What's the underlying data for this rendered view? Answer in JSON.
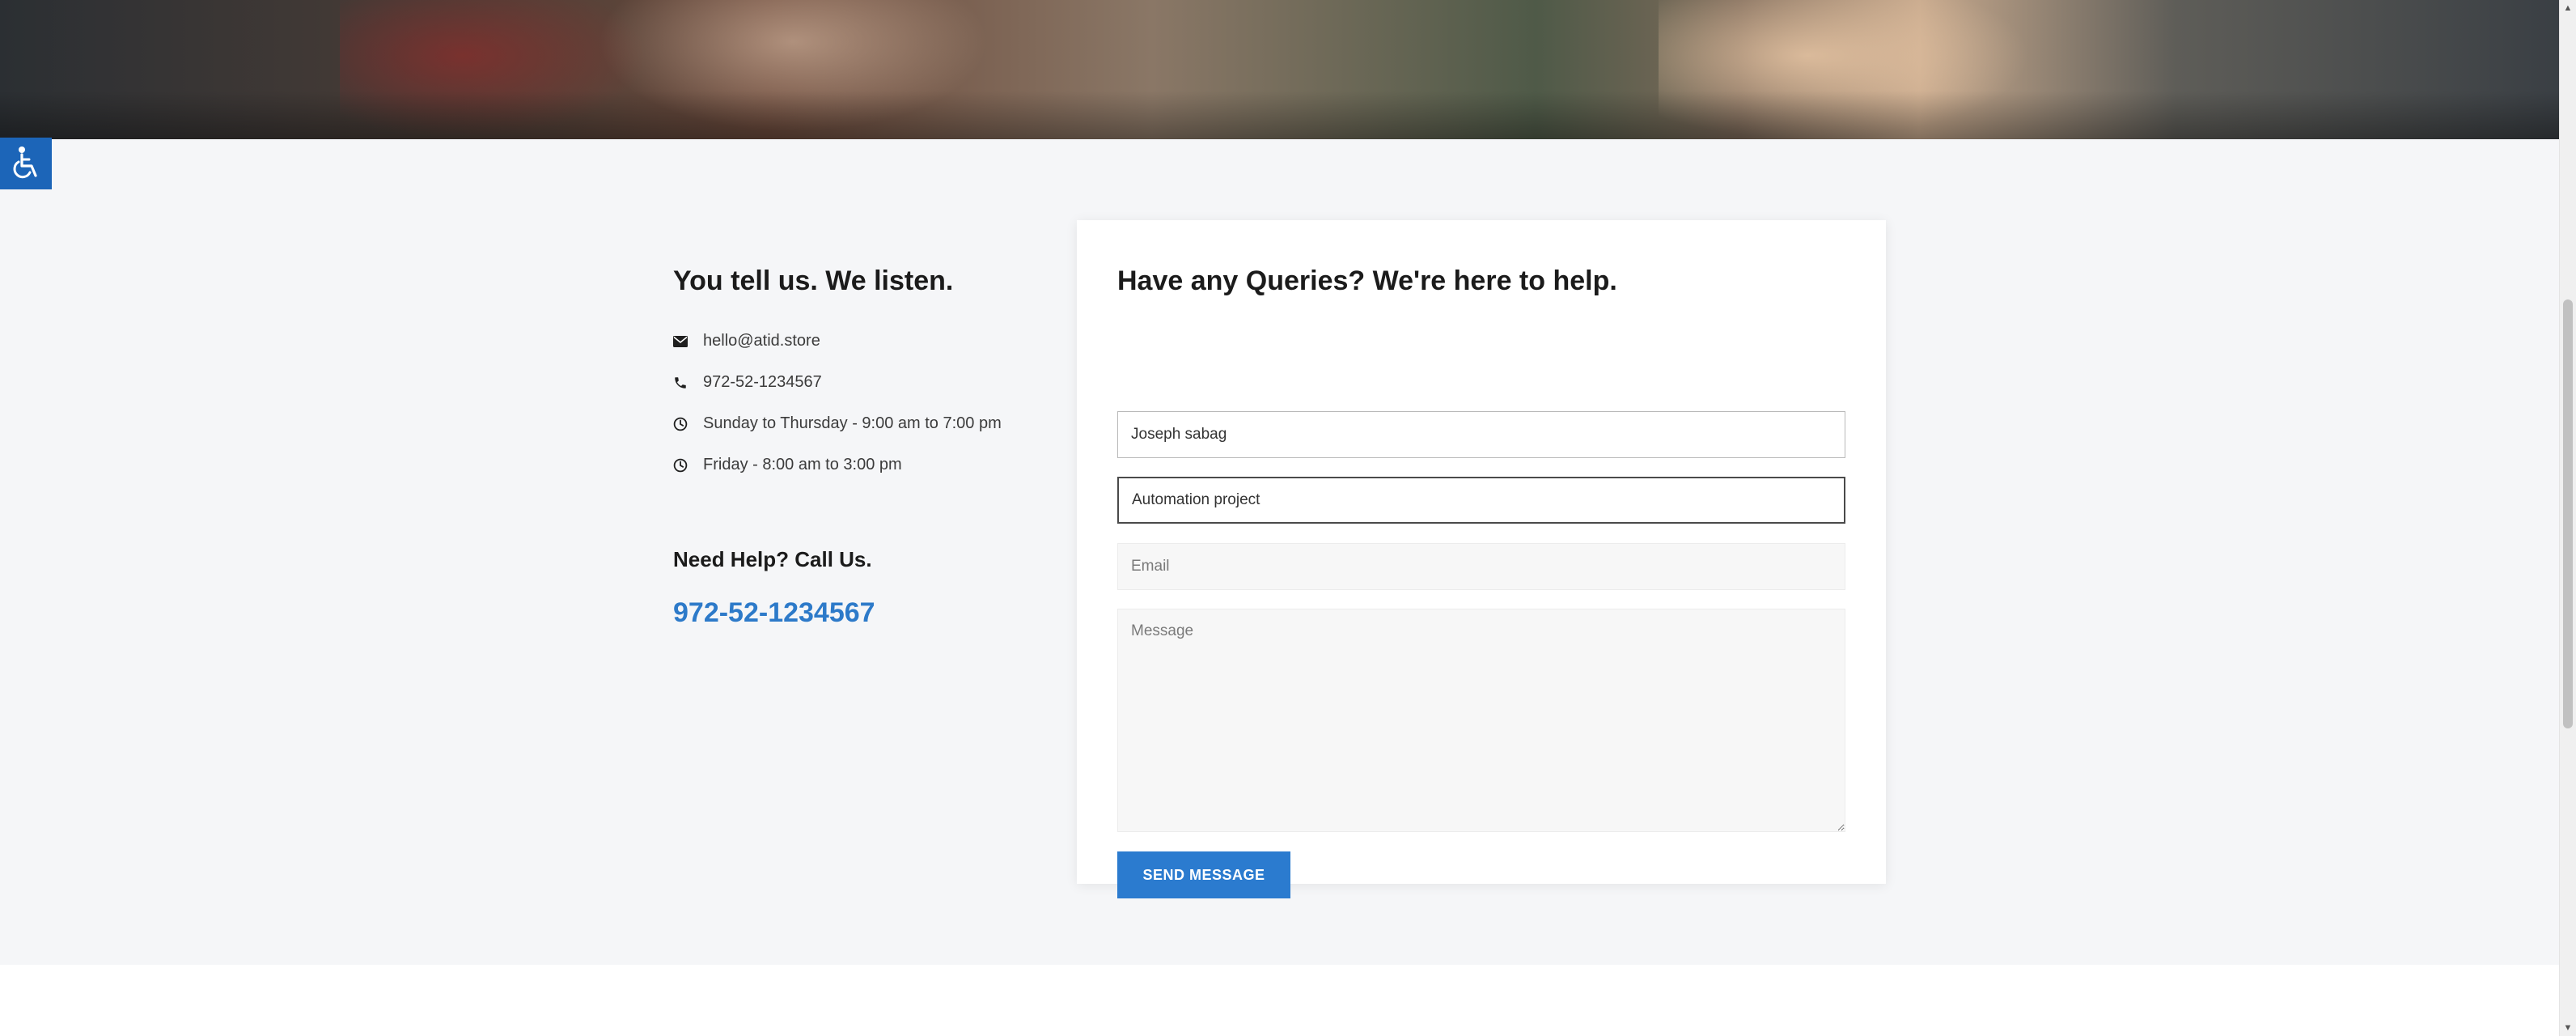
{
  "accessibility": {
    "icon": "wheelchair-icon",
    "color": "#1c65b8"
  },
  "contact_info": {
    "heading": "You tell us. We listen.",
    "items": [
      {
        "icon": "envelope-icon",
        "text": "hello@atid.store"
      },
      {
        "icon": "phone-icon",
        "text": "972-52-1234567"
      },
      {
        "icon": "clock-icon",
        "text": "Sunday to Thursday - 9:00 am to 7:00 pm"
      },
      {
        "icon": "clock-icon",
        "text": "Friday - 8:00 am to 3:00 pm"
      }
    ],
    "help_heading": "Need Help? Call Us.",
    "help_phone": "972-52-1234567",
    "accent": "#2d7ac9"
  },
  "form": {
    "heading": "Have any Queries? We're here to help.",
    "name_value": "Joseph sabag",
    "subject_value": "Automation project",
    "email_placeholder": "Email",
    "message_placeholder": "Message",
    "submit_label": "Send Message",
    "button_color": "#2b7bcf"
  }
}
